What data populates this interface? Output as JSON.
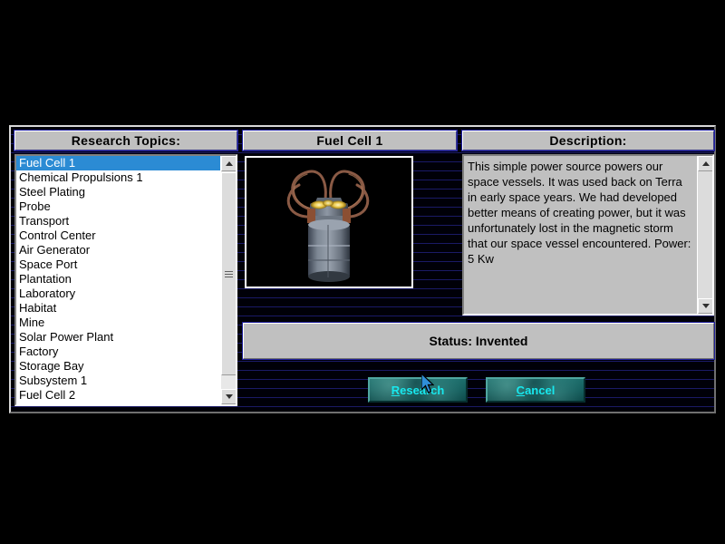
{
  "dialog": {
    "panels": {
      "topics_header": "Research Topics:",
      "item_header": "Fuel Cell 1",
      "description_header": "Description:"
    },
    "topics": [
      {
        "label": "Fuel Cell 1",
        "selected": true
      },
      {
        "label": "Chemical Propulsions 1",
        "selected": false
      },
      {
        "label": "Steel Plating",
        "selected": false
      },
      {
        "label": "Probe",
        "selected": false
      },
      {
        "label": "Transport",
        "selected": false
      },
      {
        "label": "Control Center",
        "selected": false
      },
      {
        "label": "Air Generator",
        "selected": false
      },
      {
        "label": "Space Port",
        "selected": false
      },
      {
        "label": "Plantation",
        "selected": false
      },
      {
        "label": "Laboratory",
        "selected": false
      },
      {
        "label": "Habitat",
        "selected": false
      },
      {
        "label": "Mine",
        "selected": false
      },
      {
        "label": "Solar Power Plant",
        "selected": false
      },
      {
        "label": "Factory",
        "selected": false
      },
      {
        "label": "Storage Bay",
        "selected": false
      },
      {
        "label": "Subsystem 1",
        "selected": false
      },
      {
        "label": "Fuel Cell 2",
        "selected": false
      }
    ],
    "description": "This simple power source powers our space vessels.  It was used back on Terra in early space years. We had developed better means of creating power, but it was unfortunately lost in the magnetic storm that our space vessel encountered.  Power: 5 Kw",
    "status": "Status: Invented",
    "buttons": {
      "research": {
        "accel": "R",
        "rest": "esearch"
      },
      "cancel": {
        "accel": "C",
        "rest": "ancel"
      }
    },
    "picture": {
      "name": "fuel-cell-render",
      "alt": "Fuel Cell 1 3D render"
    },
    "colors": {
      "panel_face": "#c0c0c0",
      "selection": "#2b8bd4",
      "button_face": "#15605f",
      "button_text": "#18e8ee",
      "scanline": "#1a1a66",
      "backdrop": "#000000"
    }
  }
}
